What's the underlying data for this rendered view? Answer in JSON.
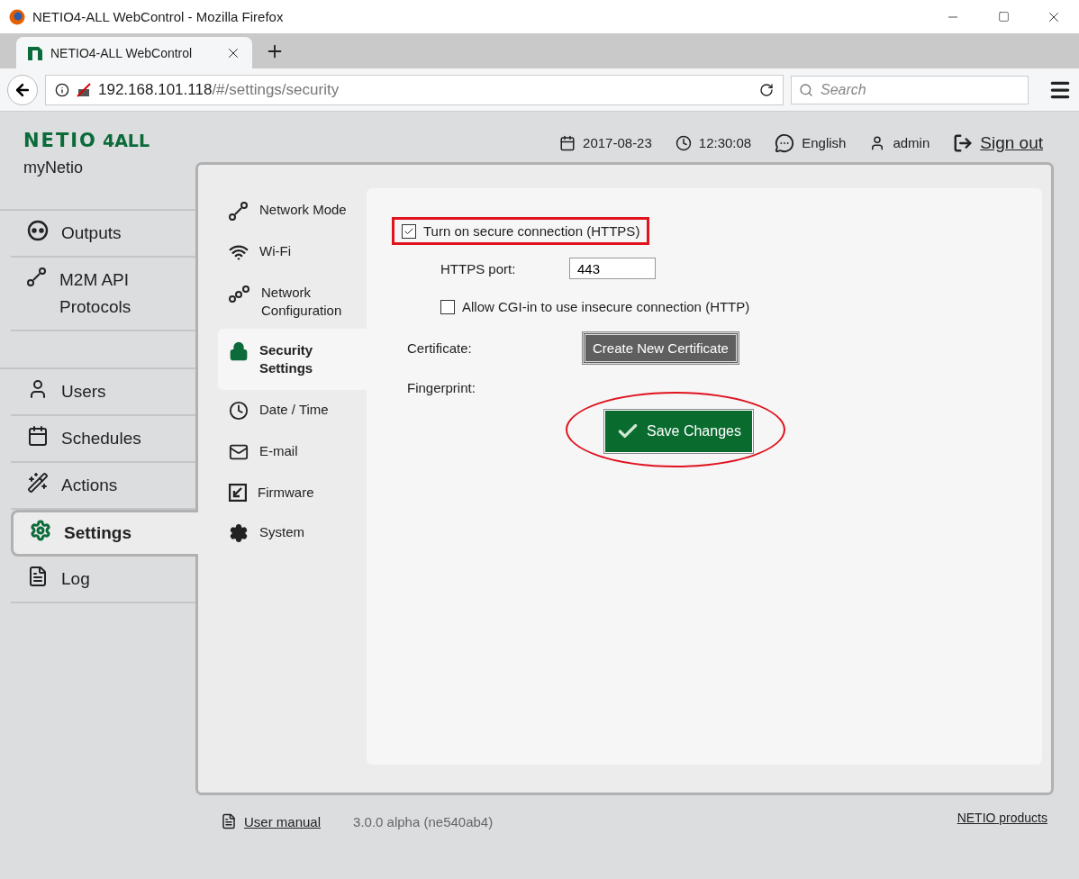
{
  "window": {
    "title": "NETIO4-ALL WebControl - Mozilla Firefox"
  },
  "tabs": [
    {
      "label": "NETIO4-ALL WebControl",
      "selected": true
    }
  ],
  "address_bar": {
    "host": "192.168.101.118",
    "path": "/#/settings/security"
  },
  "search": {
    "placeholder": "Search"
  },
  "brand": {
    "logo_main": "NETIO",
    "logo_sub": "4ALL",
    "device_name": "myNetio"
  },
  "header": {
    "date": "2017-08-23",
    "time": "12:30:08",
    "language": "English",
    "user": "admin",
    "sign_out": "Sign out"
  },
  "sidebar": {
    "groups": [
      [
        {
          "label": "Outputs",
          "selected": false
        },
        {
          "label": "M2M API Protocols",
          "selected": false
        }
      ],
      [
        {
          "label": "Users",
          "selected": false
        },
        {
          "label": "Schedules",
          "selected": false
        },
        {
          "label": "Actions",
          "selected": false
        },
        {
          "label": "Settings",
          "selected": true
        },
        {
          "label": "Log",
          "selected": false
        }
      ]
    ]
  },
  "settings_menu": [
    {
      "label": "Network Mode",
      "selected": false
    },
    {
      "label": "Wi-Fi",
      "selected": false
    },
    {
      "label": "Network Configuration",
      "selected": false
    },
    {
      "label": "Security Settings",
      "selected": true
    },
    {
      "label": "Date / Time",
      "selected": false
    },
    {
      "label": "E-mail",
      "selected": false
    },
    {
      "label": "Firmware",
      "selected": false
    },
    {
      "label": "System",
      "selected": false
    }
  ],
  "security": {
    "https": {
      "label": "Turn on secure connection (HTTPS)",
      "checked": true,
      "highlighted": true
    },
    "port": {
      "label": "HTTPS port:",
      "value": "443"
    },
    "allow_cgi": {
      "label": "Allow CGI-in to use insecure connection (HTTP)",
      "checked": false
    },
    "certificate": {
      "label": "Certificate:",
      "button": "Create New Certificate"
    },
    "fingerprint": {
      "label": "Fingerprint:"
    },
    "save": {
      "label": "Save Changes",
      "circled": true
    }
  },
  "footer": {
    "manual": "User manual",
    "version": "3.0.0 alpha (ne540ab4)",
    "products": "NETIO products"
  }
}
